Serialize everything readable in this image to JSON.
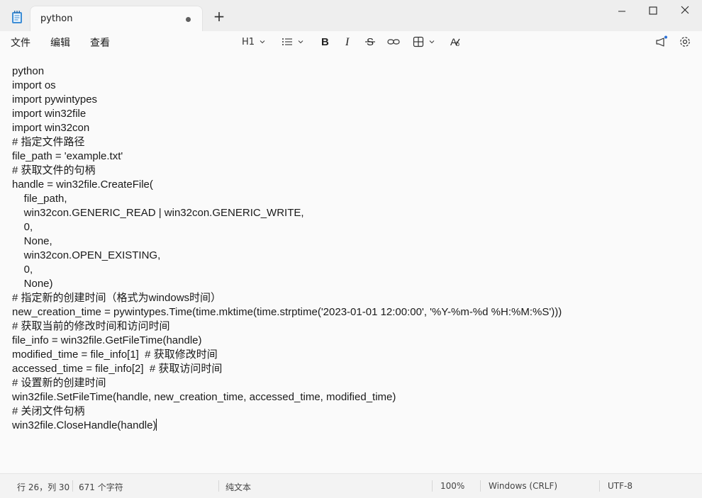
{
  "tab": {
    "title": "python",
    "modified": true
  },
  "menu": [
    "文件",
    "编辑",
    "查看"
  ],
  "toolbar": {
    "heading_label": "H1",
    "icons": [
      "list-icon",
      "bold-icon",
      "italic-icon",
      "strikethrough-icon",
      "link-icon",
      "table-icon",
      "clear-formatting-icon"
    ]
  },
  "editor": {
    "lines": [
      "python",
      "import os",
      "import pywintypes",
      "import win32file",
      "import win32con",
      "# 指定文件路径",
      "file_path = 'example.txt'",
      "# 获取文件的句柄",
      "handle = win32file.CreateFile(",
      "    file_path,",
      "    win32con.GENERIC_READ | win32con.GENERIC_WRITE,",
      "    0,",
      "    None,",
      "    win32con.OPEN_EXISTING,",
      "    0,",
      "    None)",
      "# 指定新的创建时间（格式为windows时间）",
      "new_creation_time = pywintypes.Time(time.mktime(time.strptime('2023-01-01 12:00:00', '%Y-%m-%d %H:%M:%S')))",
      "# 获取当前的修改时间和访问时间",
      "file_info = win32file.GetFileTime(handle)",
      "modified_time = file_info[1]  # 获取修改时间",
      "accessed_time = file_info[2]  # 获取访问时间",
      "# 设置新的创建时间",
      "win32file.SetFileTime(handle, new_creation_time, accessed_time, modified_time)",
      "# 关闭文件句柄",
      "win32file.CloseHandle(handle)"
    ]
  },
  "status": {
    "position": "行 26，列 30",
    "chars": "671 个字符",
    "format": "纯文本",
    "zoom": "100%",
    "line_ending": "Windows (CRLF)",
    "encoding": "UTF-8"
  }
}
